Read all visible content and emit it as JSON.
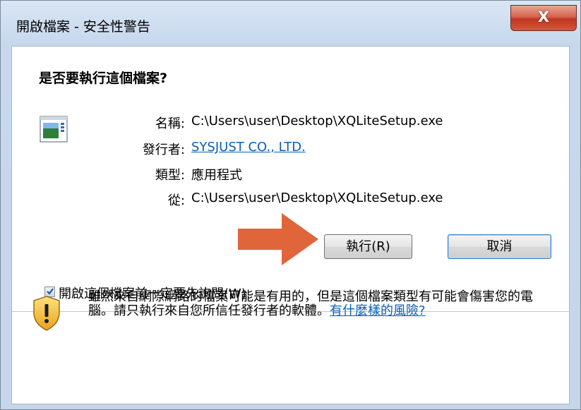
{
  "window": {
    "title": "開啟檔案 - 安全性警告",
    "close_symbol": "X"
  },
  "dialog": {
    "question": "是否要執行這個檔案?",
    "file_icon": "exe-file-icon",
    "fields": [
      {
        "label": "名稱:",
        "value": "C:\\Users\\user\\Desktop\\XQLiteSetup.exe"
      },
      {
        "label": "發行者:",
        "value": "SYSJUST CO., LTD."
      },
      {
        "label": "類型:",
        "value": "應用程式"
      },
      {
        "label": "從:",
        "value": "C:\\Users\\user\\Desktop\\XQLiteSetup.exe"
      }
    ],
    "buttons": {
      "run": "執行(R)",
      "cancel": "取消"
    },
    "checkbox": {
      "label": "開啟這個檔案前一定要先詢問(W)",
      "checked": true
    },
    "warning": {
      "text": "雖然來自網際網路的檔案可能是有用的，但是這個檔案類型有可能會傷害您的電腦。請只執行來自您所信任發行者的軟體。",
      "link": "有什麼樣的風險?"
    }
  },
  "colors": {
    "link": "#0b5fb5",
    "arrow": "#e0653a",
    "close_button": "#c7432a"
  }
}
